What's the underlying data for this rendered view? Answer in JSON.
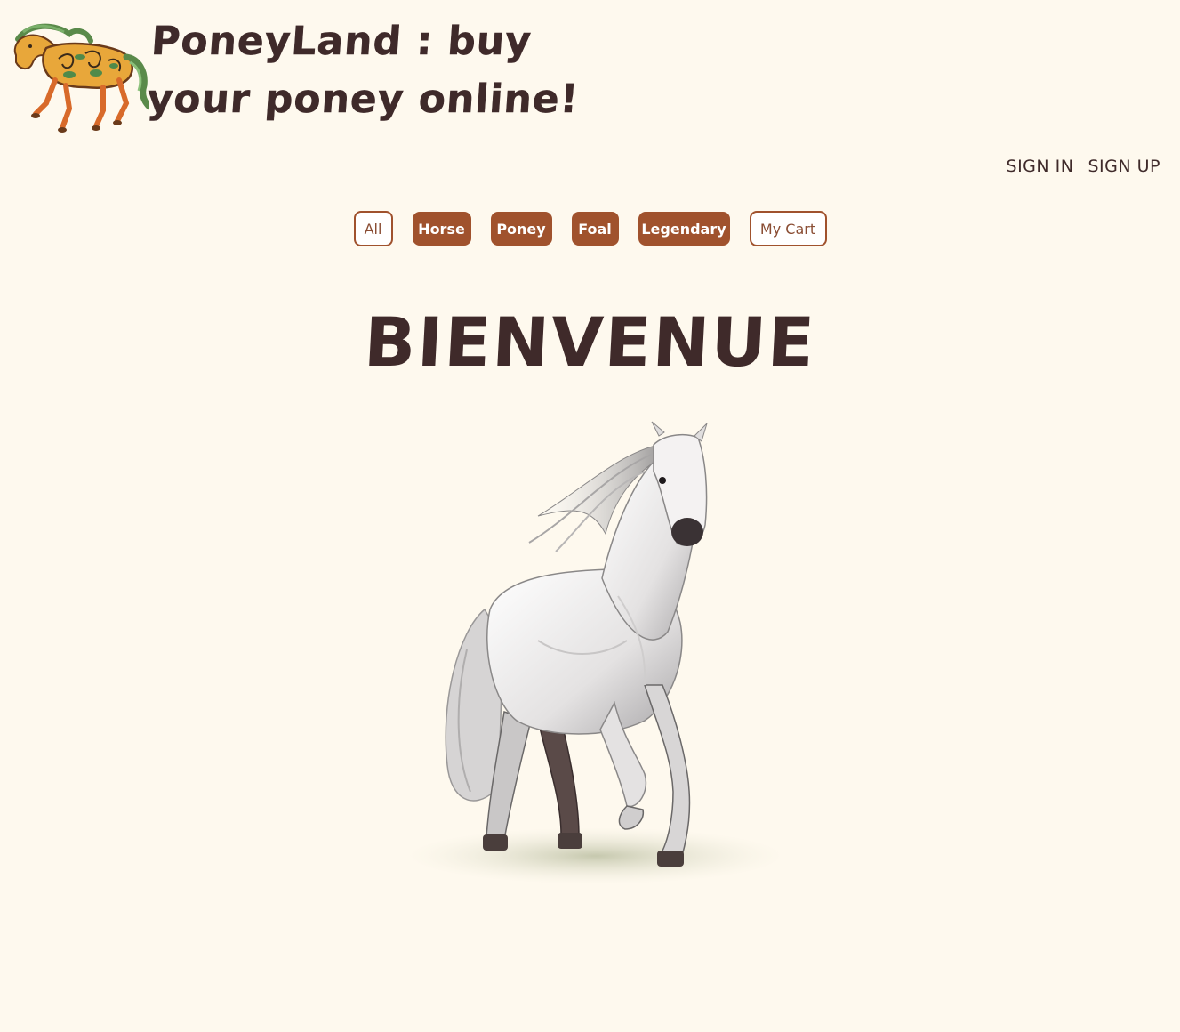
{
  "header": {
    "title": "PoneyLand : buy your poney online!",
    "logo_icon": "horse-logo-icon"
  },
  "auth": {
    "sign_in": "SIGN IN",
    "sign_up": "SIGN UP"
  },
  "nav": {
    "items": [
      {
        "label": "All",
        "style": "outline"
      },
      {
        "label": "Horse",
        "style": "filled"
      },
      {
        "label": "Poney",
        "style": "filled"
      },
      {
        "label": "Foal",
        "style": "filled"
      },
      {
        "label": "Legendary",
        "style": "filled"
      },
      {
        "label": "My Cart",
        "style": "outline"
      }
    ]
  },
  "main": {
    "welcome": "BIENVENUE",
    "hero_icon": "white-horse-illustration"
  },
  "colors": {
    "background": "#fef9ee",
    "accent": "#a0522d",
    "text": "#3f2a2a"
  }
}
